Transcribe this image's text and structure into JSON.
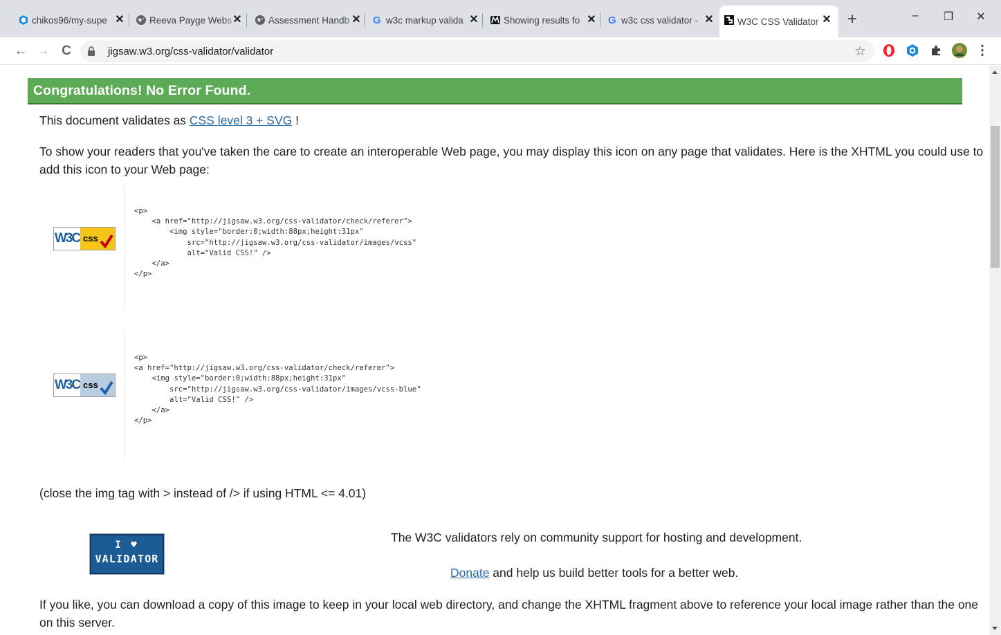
{
  "browser": {
    "tabs": [
      {
        "label": "chikos96/my-supe",
        "icon": "github-hexagon-icon"
      },
      {
        "label": "Reeva Payge Webs",
        "icon": "globe-icon"
      },
      {
        "label": "Assessment Handb",
        "icon": "globe-icon"
      },
      {
        "label": "w3c markup valida",
        "icon": "google-icon"
      },
      {
        "label": "Showing results fo",
        "icon": "mdn-icon"
      },
      {
        "label": "w3c css validator -",
        "icon": "google-icon"
      },
      {
        "label": "W3C CSS Validator",
        "icon": "w3c-icon",
        "active": true
      }
    ],
    "close_glyph": "✕",
    "new_tab_glyph": "+",
    "window_controls": {
      "minimize": "–",
      "restore": "❐",
      "close": "✕"
    },
    "nav": {
      "back": "←",
      "forward": "→",
      "reload": "C"
    },
    "url": "jigsaw.w3.org/css-validator/validator",
    "bookmark_glyph": "☆",
    "extensions": [
      "opera-icon",
      "hex-extension-icon",
      "puzzle-icon",
      "profile-avatar"
    ],
    "menu_glyph": "⋮"
  },
  "page": {
    "banner": "Congratulations! No Error Found.",
    "validates_prefix": "This document validates as ",
    "validates_link": "CSS level 3 + SVG",
    "validates_suffix": " !",
    "intro_line1": "To show your readers that you've taken the care to create an interoperable Web page, you may display this icon on any page that validates. Here is the XHTML you could use to",
    "intro_line2": "add this icon to your Web page:",
    "badge_w3c": "W3C",
    "badge_css": "css",
    "code_gold": "<p>\n    <a href=\"http://jigsaw.w3.org/css-validator/check/referer\">\n        <img style=\"border:0;width:88px;height:31px\"\n            src=\"http://jigsaw.w3.org/css-validator/images/vcss\"\n            alt=\"Valid CSS!\" />\n    </a>\n</p>",
    "code_blue": "<p>\n<a href=\"http://jigsaw.w3.org/css-validator/check/referer\">\n    <img style=\"border:0;width:88px;height:31px\"\n        src=\"http://jigsaw.w3.org/css-validator/images/vcss-blue\"\n        alt=\"Valid CSS!\" />\n    </a>\n</p>",
    "close_note": "(close the img tag with > instead of /> if using HTML <= 4.01)",
    "iloval_line1": "I ♥",
    "iloval_line2": "VALIDATOR",
    "support_text": "The W3C validators rely on community support for hosting and development.",
    "donate_link": "Donate",
    "donate_suffix": " and help us build better tools for a better web.",
    "download_line1": "If you like, you can download a copy of this image to keep in your local web directory, and change the XHTML fragment above to reference your local image rather than the one",
    "download_line2": "on this server."
  },
  "colors": {
    "banner_green": "#5daa57",
    "link_blue": "#2d6aa3",
    "tabstrip_gray": "#dee1e6"
  }
}
